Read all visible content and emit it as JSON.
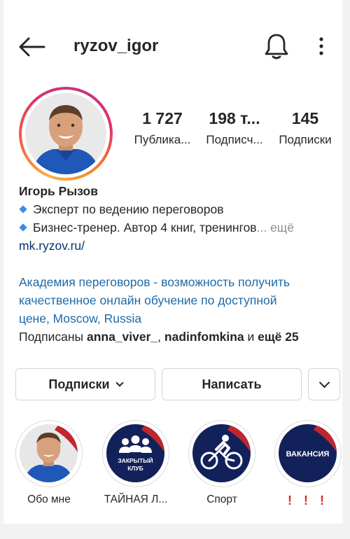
{
  "header": {
    "username": "ryzov_igor"
  },
  "stats": [
    {
      "value": "1 727",
      "label": "Публика..."
    },
    {
      "value": "198 т...",
      "label": "Подписч..."
    },
    {
      "value": "145",
      "label": "Подписки"
    }
  ],
  "bio": {
    "name": "Игорь Рызов",
    "line1": "Эксперт по ведению переговоров",
    "line2": "Бизнес-тренер. Автор 4 книг, тренингов",
    "more_dots": "...",
    "more": "ещё",
    "website": "mk.ryzov.ru/",
    "category_line1": "Академия переговоров - возможность получить",
    "category_line2": "качественное онлайн обучение по доступной",
    "category_line3": "цене, Moscow, Russia",
    "followed_prefix": "Подписаны ",
    "followed_user1": "anna_viver_",
    "followed_sep": ", ",
    "followed_user2": "nadinfomkina",
    "followed_and": " и ",
    "followed_more": "ещё 25"
  },
  "actions": {
    "following_label": "Подписки",
    "message_label": "Написать"
  },
  "highlights": [
    {
      "label": "Обо мне"
    },
    {
      "label": "ТАЙНАЯ Л...",
      "cover_text_1": "ЗАКРЫТЫЙ",
      "cover_text_2": "КЛУБ"
    },
    {
      "label": "Спорт"
    },
    {
      "label": "! ! !",
      "cover_text": "ВАКАНСИЯ"
    }
  ],
  "colors": {
    "link": "#00376b",
    "bio_blue": "#1e6aa8",
    "highlight_bg": "#13215a",
    "alert_red": "#e0262b"
  }
}
